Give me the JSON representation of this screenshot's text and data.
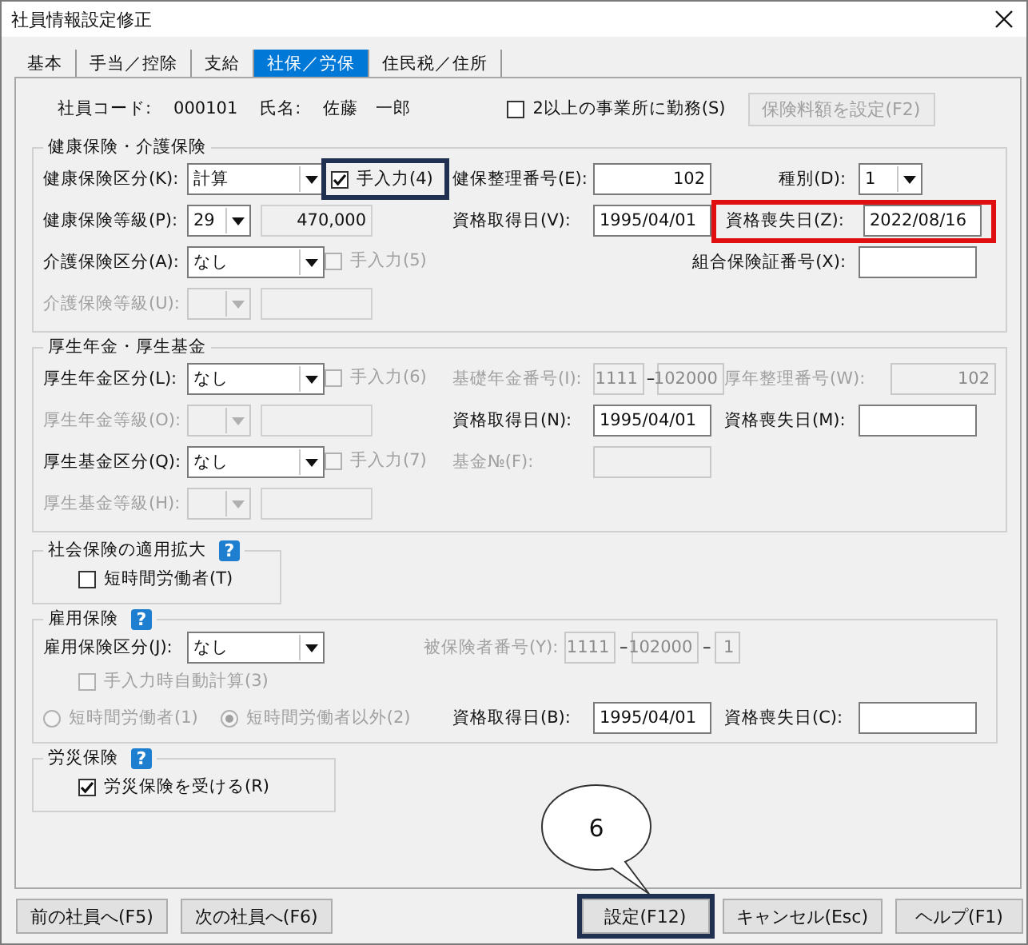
{
  "window": {
    "title": "社員情報設定修正"
  },
  "tabs": [
    {
      "label": "基本",
      "selected": false
    },
    {
      "label": "手当／控除",
      "selected": false
    },
    {
      "label": "支給",
      "selected": false
    },
    {
      "label": "社保／労保",
      "selected": true
    },
    {
      "label": "住民税／住所",
      "selected": false
    }
  ],
  "employee": {
    "code_label": "社員コード:",
    "code": "000101",
    "name_label": "氏名:",
    "name": "佐藤　一郎"
  },
  "multi_office": {
    "label": "2以上の事業所に勤務(S)",
    "checked": false
  },
  "premium_button": {
    "label": "保険料額を設定(F2)",
    "disabled": true
  },
  "health": {
    "title": "健康保険・介護保険",
    "category": {
      "label": "健康保険区分(K):",
      "value": "計算"
    },
    "manual": {
      "label": "手入力(4)",
      "checked": true,
      "disabled": false,
      "highlighted": true
    },
    "number": {
      "label": "健保整理番号(E):",
      "value": "102"
    },
    "type": {
      "label": "種別(D):",
      "value": "1"
    },
    "grade": {
      "label": "健康保険等級(P):",
      "value": "29",
      "amount": "470,000"
    },
    "acquired": {
      "label": "資格取得日(V):",
      "value": "1995/04/01"
    },
    "lost": {
      "label": "資格喪失日(Z):",
      "value": "2022/08/16",
      "alert": true
    },
    "care_category": {
      "label": "介護保険区分(A):",
      "value": "なし"
    },
    "care_manual": {
      "label": "手入力(5)",
      "checked": false,
      "disabled": true
    },
    "union_card": {
      "label": "組合保険証番号(X):"
    },
    "care_grade": {
      "label": "介護保険等級(U):",
      "disabled": true
    }
  },
  "pension": {
    "title": "厚生年金・厚生基金",
    "category": {
      "label": "厚生年金区分(L):",
      "value": "なし"
    },
    "manual": {
      "label": "手入力(6)",
      "checked": false,
      "disabled": true
    },
    "basic_number": {
      "label": "基礎年金番号(I):",
      "disabled": true,
      "parts": [
        {
          "kind": "field",
          "text": "1111"
        },
        {
          "kind": "dash",
          "text": "–"
        },
        {
          "kind": "field",
          "text": "102000"
        }
      ]
    },
    "number": {
      "label": "厚年整理番号(W):",
      "value": "102",
      "disabled": true
    },
    "grade": {
      "label": "厚生年金等級(O):",
      "disabled": true
    },
    "acquired": {
      "label": "資格取得日(N):",
      "value": "1995/04/01"
    },
    "lost": {
      "label": "資格喪失日(M):"
    },
    "fund_category": {
      "label": "厚生基金区分(Q):",
      "value": "なし"
    },
    "fund_manual": {
      "label": "手入力(7)",
      "checked": false,
      "disabled": true
    },
    "fund_number": {
      "label": "基金№(F):",
      "disabled": true
    },
    "fund_grade": {
      "label": "厚生基金等級(H):",
      "disabled": true
    }
  },
  "expansion": {
    "title": "社会保険の適用拡大",
    "help": "?",
    "short_time": {
      "label": "短時間労働者(T)",
      "checked": false
    }
  },
  "employment": {
    "title": "雇用保険",
    "help": "?",
    "category": {
      "label": "雇用保険区分(J):",
      "value": "なし"
    },
    "insured_number": {
      "label": "被保険者番号(Y):",
      "disabled": true,
      "parts": [
        {
          "kind": "field",
          "text": "1111"
        },
        {
          "kind": "dash",
          "text": "–"
        },
        {
          "kind": "field",
          "text": "102000"
        },
        {
          "kind": "dash",
          "text": "–"
        },
        {
          "kind": "field",
          "text": "1"
        }
      ]
    },
    "auto_calc": {
      "label": "手入力時自動計算(3)",
      "checked": false,
      "disabled": true
    },
    "work_type": [
      {
        "label": "短時間労働者(1)",
        "selected": false,
        "disabled": true
      },
      {
        "label": "短時間労働者以外(2)",
        "selected": true,
        "disabled": true
      }
    ],
    "acquired": {
      "label": "資格取得日(B):",
      "value": "1995/04/01"
    },
    "lost": {
      "label": "資格喪失日(C):"
    }
  },
  "rousai": {
    "title": "労災保険",
    "help": "?",
    "receive": {
      "label": "労災保険を受ける(R)",
      "checked": true
    }
  },
  "callout": {
    "text": "6"
  },
  "buttons_left": [
    {
      "label": "前の社員へ(F5)",
      "highlighted": false
    },
    {
      "label": "次の社員へ(F6)",
      "highlighted": false
    }
  ],
  "buttons_right": [
    {
      "label": "設定(F12)",
      "highlighted": true
    },
    {
      "label": "キャンセル(Esc)",
      "highlighted": false
    },
    {
      "label": "ヘルプ(F1)",
      "highlighted": false
    }
  ]
}
